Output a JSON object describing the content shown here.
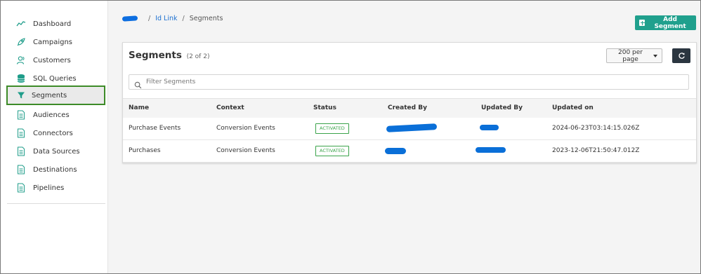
{
  "sidebar": {
    "items": [
      {
        "label": "Dashboard",
        "icon": "chart-line-icon"
      },
      {
        "label": "Campaigns",
        "icon": "rocket-icon"
      },
      {
        "label": "Customers",
        "icon": "users-icon"
      },
      {
        "label": "SQL Queries",
        "icon": "database-icon"
      },
      {
        "label": "Segments",
        "icon": "filter-icon",
        "active": true
      },
      {
        "label": "Audiences",
        "icon": "document-icon"
      },
      {
        "label": "Connectors",
        "icon": "document-icon"
      },
      {
        "label": "Data Sources",
        "icon": "document-icon"
      },
      {
        "label": "Destinations",
        "icon": "document-icon"
      },
      {
        "label": "Pipelines",
        "icon": "document-icon"
      }
    ]
  },
  "breadcrumb": {
    "link": "Id Link",
    "separator": "/",
    "current": "Segments"
  },
  "actions": {
    "add_segment": "Add Segment"
  },
  "segments": {
    "title": "Segments",
    "count": "(2 of 2)",
    "per_page": "200 per page",
    "filter_placeholder": "Filter Segments",
    "columns": [
      "Name",
      "Context",
      "Status",
      "Created By",
      "Updated By",
      "Updated on"
    ],
    "rows": [
      {
        "name": "Purchase Events",
        "context": "Conversion Events",
        "status": "ACTIVATED",
        "updated_on": "2024-06-23T03:14:15.026Z"
      },
      {
        "name": "Purchases",
        "context": "Conversion Events",
        "status": "ACTIVATED",
        "updated_on": "2023-12-06T21:50:47.012Z"
      }
    ]
  },
  "colors": {
    "accent": "#20a08d",
    "active_outline": "#3d8b28",
    "status_green": "#3aa34a",
    "link_blue": "#1b6fd0",
    "redaction_blue": "#0a6fd8",
    "icon_teal": "#1f9d8a"
  }
}
